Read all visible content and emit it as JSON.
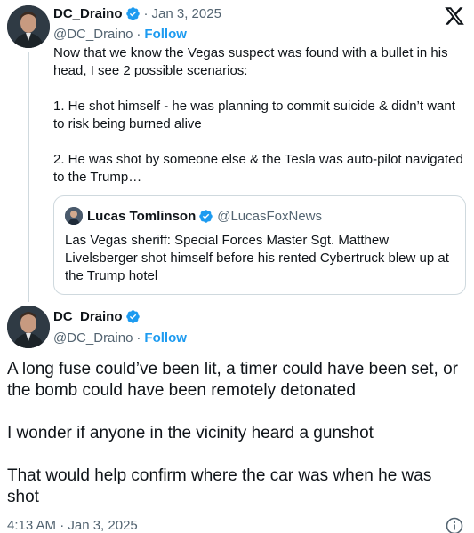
{
  "parent_tweet": {
    "display_name": "DC_Draino",
    "date": "Jan 3, 2025",
    "separator": "·",
    "handle": "@DC_Draino",
    "follow_label": "Follow",
    "paragraphs": [
      "Now that we know the Vegas suspect was found with a bullet in his head, I see 2 possible scenarios:",
      "1. He shot himself - he was planning to commit suicide & didn’t want to risk being burned alive",
      "2. He was shot by someone else & the Tesla was auto-pilot navigated to the Trump…"
    ],
    "quote": {
      "display_name": "Lucas Tomlinson",
      "handle": "@LucasFoxNews",
      "text": "Las Vegas sheriff: Special Forces Master Sgt. Matthew Livelsberger shot himself before his rented Cybertruck blew up at the Trump hotel"
    }
  },
  "main_tweet": {
    "display_name": "DC_Draino",
    "handle": "@DC_Draino",
    "follow_label": "Follow",
    "paragraphs": [
      "A long fuse could’ve been lit, a timer could have been set, or the bomb could have been remotely detonated",
      "I wonder if anyone in the vicinity heard a gunshot",
      "That would help confirm where the car was when he was shot"
    ],
    "timestamp": "4:13 AM · Jan 3, 2025"
  },
  "colors": {
    "text": "#0f1419",
    "secondary": "#536471",
    "accent": "#1d9bf0",
    "border": "#cfd9de"
  },
  "icons": [
    "x-logo-icon",
    "verified-badge-icon",
    "info-icon"
  ]
}
